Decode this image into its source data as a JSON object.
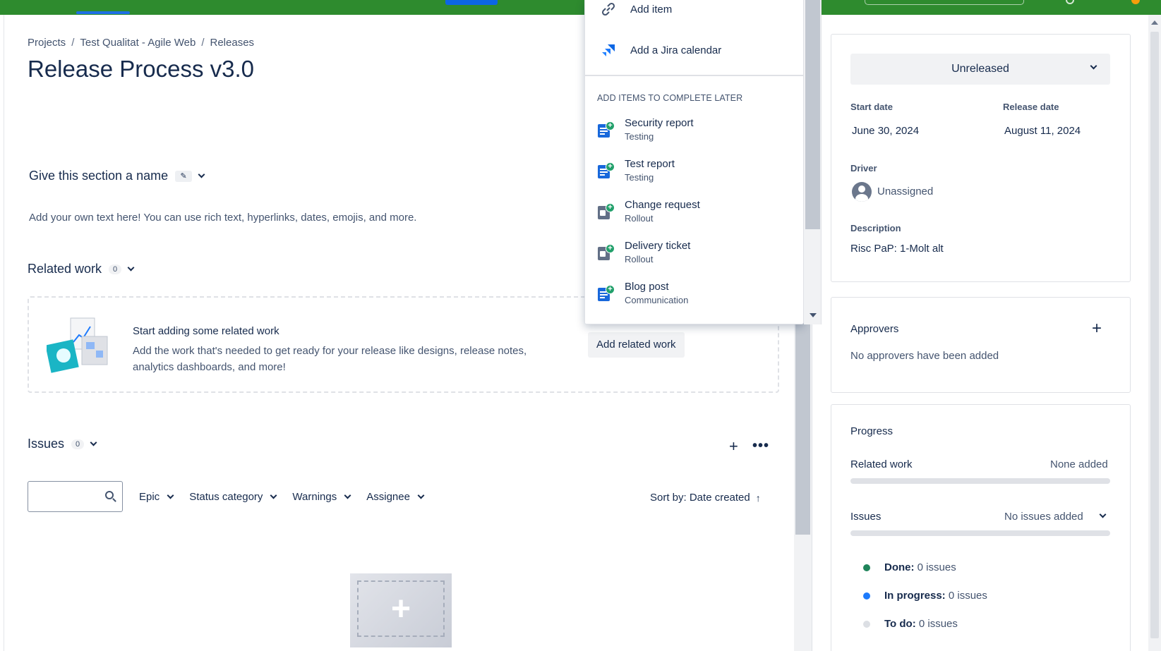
{
  "breadcrumb": [
    "Projects",
    "Test Qualitat - Agile Web",
    "Releases"
  ],
  "page_title": "Release Process v3.0",
  "section": {
    "title": "Give this section a name",
    "description": "Add your own text here! You can use rich text, hyperlinks, dates, emojis, and more."
  },
  "related_work": {
    "title": "Related work",
    "count": "0",
    "empty_title": "Start adding some related work",
    "empty_desc": "Add the work that's needed to get ready for your release like designs, release notes, analytics dashboards, and more!",
    "button": "Add related work"
  },
  "issues": {
    "title": "Issues",
    "count": "0",
    "add": "+",
    "more": "•••",
    "search_value": "",
    "filters": [
      "Epic",
      "Status category",
      "Warnings",
      "Assignee"
    ],
    "sort": "Sort by: Date created",
    "sort_arrow": "↑"
  },
  "dropdown": {
    "items": [
      {
        "label": "Add item",
        "icon": "link-icon"
      },
      {
        "label": "Add a Jira calendar",
        "icon": "jira-icon"
      }
    ],
    "section_label": "ADD ITEMS TO COMPLETE LATER",
    "later_items": [
      {
        "title": "Security report",
        "subtitle": "Testing",
        "icon": "document-add-icon",
        "color": "#1868db"
      },
      {
        "title": "Test report",
        "subtitle": "Testing",
        "icon": "document-add-icon",
        "color": "#1868db"
      },
      {
        "title": "Change request",
        "subtitle": "Rollout",
        "icon": "copy-add-icon",
        "color": "#626f86"
      },
      {
        "title": "Delivery ticket",
        "subtitle": "Rollout",
        "icon": "copy-add-icon",
        "color": "#626f86"
      },
      {
        "title": "Blog post",
        "subtitle": "Communication",
        "icon": "document-add-icon",
        "color": "#1868db"
      }
    ]
  },
  "details": {
    "status": "Unreleased",
    "start_date_label": "Start date",
    "start_date": "June 30, 2024",
    "release_date_label": "Release date",
    "release_date": "August 11, 2024",
    "driver_label": "Driver",
    "driver": "Unassigned",
    "description_label": "Description",
    "description": "Risc PaP: 1-Molt alt"
  },
  "approvers": {
    "title": "Approvers",
    "add": "+",
    "empty": "No approvers have been added"
  },
  "progress": {
    "title": "Progress",
    "related_label": "Related work",
    "related_value": "None added",
    "issues_label": "Issues",
    "issues_value": "No issues added",
    "legend": [
      {
        "label": "Done:",
        "value": "0 issues",
        "color": "#1f845a"
      },
      {
        "label": "In progress:",
        "value": "0 issues",
        "color": "#1d7afc"
      },
      {
        "label": "To do:",
        "value": "0 issues",
        "color": "#dcdfe4"
      }
    ]
  },
  "colors": {
    "topbar": "#2e8b2e",
    "accent": "#0c66e4"
  }
}
